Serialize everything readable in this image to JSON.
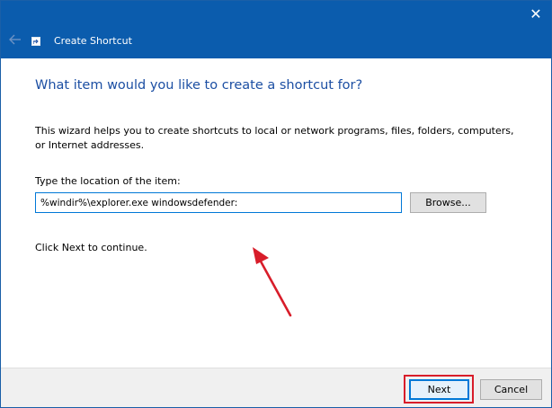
{
  "window": {
    "title": "Create Shortcut",
    "close_glyph": "✕",
    "back_icon": "back-arrow-icon",
    "app_icon": "shortcut-icon"
  },
  "main": {
    "heading": "What item would you like to create a shortcut for?",
    "description": "This wizard helps you to create shortcuts to local or network programs, files, folders, computers, or Internet addresses.",
    "location_label": "Type the location of the item:",
    "location_value": "%windir%\\explorer.exe windowsdefender:",
    "browse_label": "Browse...",
    "continue_text": "Click Next to continue."
  },
  "footer": {
    "next_label": "Next",
    "cancel_label": "Cancel"
  },
  "colors": {
    "titlebar": "#0b5cad",
    "heading": "#1c4fa3",
    "annotation": "#d81d2a",
    "focus": "#0078d7"
  }
}
